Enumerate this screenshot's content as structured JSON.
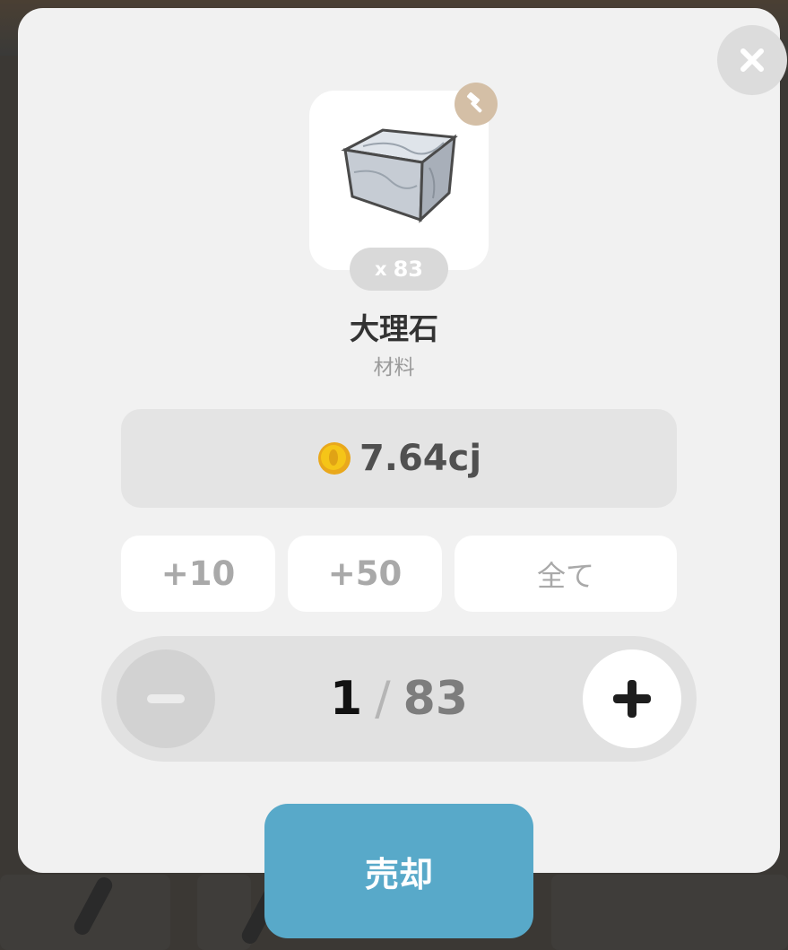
{
  "item": {
    "name": "大理石",
    "category": "材料",
    "owned_prefix": "x",
    "owned_count": "83",
    "image_icon": "marble-block-icon",
    "badge_icon": "hammer-icon"
  },
  "price": {
    "amount": "7.64cj",
    "currency_icon": "gold-coin-icon"
  },
  "quick_add": {
    "plus10": "+10",
    "plus50": "+50",
    "all": "全て"
  },
  "stepper": {
    "current": "1",
    "separator": "/",
    "max": "83",
    "minus_icon": "minus-icon",
    "plus_icon": "plus-icon"
  },
  "actions": {
    "sell": "売却",
    "close_icon": "close-icon"
  },
  "colors": {
    "modal_bg": "#f1f1f1",
    "sell_button": "#58a9c9",
    "badge_tan": "#d4bfa6",
    "coin_gold": "#f5c518"
  }
}
